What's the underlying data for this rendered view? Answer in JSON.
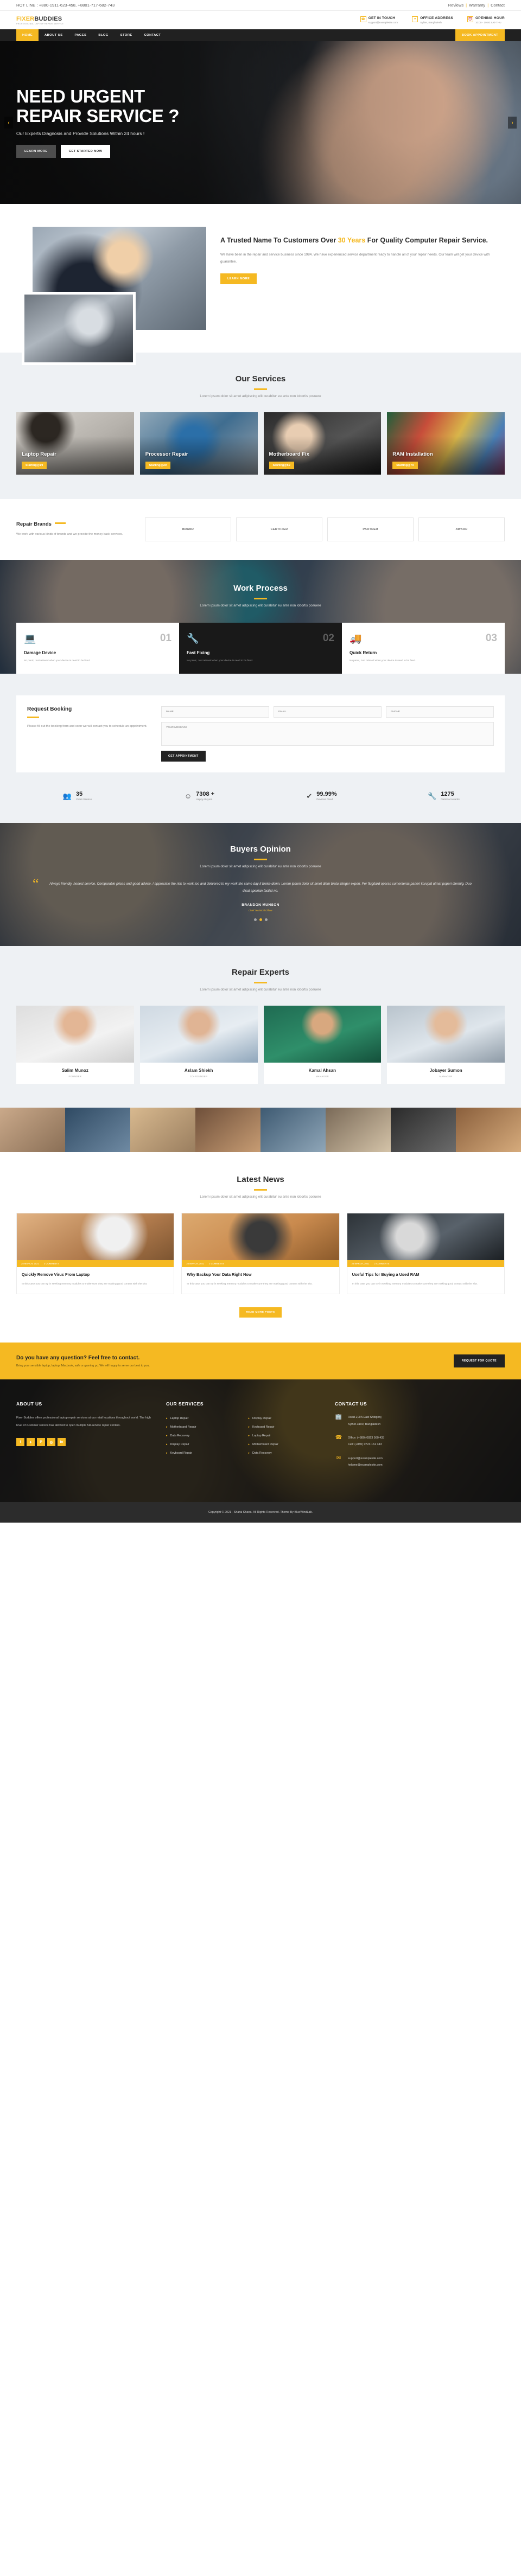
{
  "topbar": {
    "hotline": "HOT LINE : +880-1911-623-458, +8801-717-682-743",
    "links": [
      "Reviews",
      "Warranty",
      "Contact"
    ]
  },
  "header": {
    "logo_a": "FIXER",
    "logo_b": "BUDDIES",
    "logo_tagline": "PROFESSIONAL LAPTOP REPAIR SERVICE",
    "blocks": [
      {
        "icon": "phone-icon",
        "title": "GET IN TOUCH",
        "sub": "support@examplesite.com"
      },
      {
        "icon": "map-pin-icon",
        "title": "OFFICE ADDRESS",
        "sub": "Sylhet, Bangladesh"
      },
      {
        "icon": "clock-icon",
        "title": "OPENING HOUR",
        "sub": "10:00 - 19:00 SAT-THU"
      }
    ]
  },
  "nav": {
    "items": [
      "HOME",
      "ABOUT US",
      "PAGES",
      "BLOG",
      "STORE",
      "CONTACT"
    ],
    "active": "HOME",
    "cta": "BOOK APPOINTMENT"
  },
  "hero": {
    "title_line1": "NEED URGENT",
    "title_line2": "REPAIR SERVICE ?",
    "subtitle": "Our Experts Diagnosis and Provide Solutions Within 24 hours !",
    "btn_primary": "LEARN MORE",
    "btn_secondary": "GET STARTED NOW",
    "prev_icon": "chevron-left-icon",
    "next_icon": "chevron-right-icon"
  },
  "about": {
    "heading_pre": "A Trusted Name To Customers Over ",
    "heading_hl": "30 Years",
    "heading_post": " For Quality Computer Repair Service.",
    "body": "We have been in the repair and service business since 1984. We have experienced service department ready to handle all of your repair needs. Our team will get your device with guarantee.",
    "button": "LEARN MORE"
  },
  "services": {
    "title": "Our Services",
    "subtitle": "Lorem ipsum dolor sit amet adipiscing elit curabitur eu ante non lobortis posuere",
    "cards": [
      {
        "name": "Laptop Repair",
        "price": "Starting@19"
      },
      {
        "name": "Processor Repair",
        "price": "Starting@29"
      },
      {
        "name": "Motherboard Fix",
        "price": "Starting@59"
      },
      {
        "name": "RAM Installation",
        "price": "Starting@79"
      }
    ]
  },
  "brands": {
    "title": "Repair Brands",
    "desc": "We work with various kinds of brands and we provide the money back services.",
    "logos": [
      "BRAND",
      "CERTIFIED",
      "PARTNER",
      "AWARD"
    ]
  },
  "work": {
    "title": "Work Process",
    "subtitle": "Lorem ipsum dolor sit amet adipiscing elit curabitur eu ante non lobortis posuere",
    "steps": [
      {
        "icon": "laptop-icon",
        "num": "01",
        "title": "Damage Device",
        "text": "No panic, Just relaxed when your device is need to be fixed."
      },
      {
        "icon": "wrench-icon",
        "num": "02",
        "title": "Fast Fixing",
        "text": "No panic, Just relaxed when your device is need to be fixed."
      },
      {
        "icon": "truck-icon",
        "num": "03",
        "title": "Quick Return",
        "text": "No panic, Just relaxed when your device is need to be fixed."
      }
    ]
  },
  "booking": {
    "title": "Request Booking",
    "desc": "Please fill out the booking form and soon we will contact you to schedule an appointment.",
    "name_placeholder": "NAME",
    "email_placeholder": "EMAIL",
    "phone_placeholder": "PHONE",
    "message_placeholder": "YOUR MESSAGE",
    "submit": "GET APPOINTMENT"
  },
  "counters": [
    {
      "icon": "users-icon",
      "number": "35",
      "label": "Years Service"
    },
    {
      "icon": "smile-icon",
      "number": "7308 +",
      "label": "Happy Buyers"
    },
    {
      "icon": "check-icon",
      "number": "99.99%",
      "label": "Devices Fixed"
    },
    {
      "icon": "wrench-icon",
      "number": "1275",
      "label": "National Awards"
    }
  ],
  "testimonial": {
    "title": "Buyers Opinion",
    "subtitle": "Lorem ipsum dolor sit amet adipiscing elit curabitur eu ante non lobortis posuere",
    "quote": "Always friendly, honest service. Comparable prices and good advice. I appreciate the risk to work too and delivered to my work the same day it broke down. Lorem ipsum dolor sit amet diam bratu integer experi. Per flugitard operas cumenteras parteri korupid utmat poperi diermig. Duo dicat apeirian facilisi ne.",
    "author": "BRANDON MUNSON",
    "role": "Chief Technical Officer",
    "dots": 3,
    "active_dot": 1
  },
  "experts": {
    "title": "Repair Experts",
    "subtitle": "Lorem ipsum dolor sit amet adipiscing elit curabitur eu ante non lobortis posuere",
    "people": [
      {
        "name": "Salim Munoz",
        "role": "FOUNDER"
      },
      {
        "name": "Aslam Shiekh",
        "role": "CO-FOUNDER"
      },
      {
        "name": "Kamal Ahsan",
        "role": "MANAGER"
      },
      {
        "name": "Jobayer Sumon",
        "role": "MANAGER"
      }
    ]
  },
  "news": {
    "title": "Latest News",
    "subtitle": "Lorem ipsum dolor sit amet adipiscing elit curabitur eu ante non lobortis posuere",
    "posts": [
      {
        "date": "25 MARCH, 2021",
        "comments": "2 COMMENTS",
        "title": "Quickly Remove Virus From Laptop",
        "excerpt": "In this case you can try in seeking memory modules to make sure they are making good contact with the slot."
      },
      {
        "date": "25 MARCH, 2021",
        "comments": "2 COMMENTS",
        "title": "Why Backup Your Data Right Now",
        "excerpt": "In this case you can try in seeking memory modules to make sure they are making good contact with the slot."
      },
      {
        "date": "25 MARCH, 2021",
        "comments": "2 COMMENTS",
        "title": "Useful Tips for Buying a Used RAM",
        "excerpt": "In this case you can try in seeking memory modules to make sure they are making good contact with the slot."
      }
    ],
    "more_button": "READ MORE POSTS"
  },
  "cta": {
    "title": "Do you have any question? Feel free to contact.",
    "sub": "Bring your sensible laptop, laptop, Macbook, safe or gaming pc. We will happy to serve our best to you.",
    "button": "REQUEST FOR QUOTE"
  },
  "footer": {
    "about_title": "ABOUT US",
    "about_text": "Fixer Buddies offers professional laptop repair services at our retail locations throughout world. The high level of customer service has allowed to open multiple full-service repair centers.",
    "socials": [
      {
        "name": "facebook-icon",
        "glyph": "f"
      },
      {
        "name": "twitter-icon",
        "glyph": "✦"
      },
      {
        "name": "pinterest-icon",
        "glyph": "P"
      },
      {
        "name": "instagram-icon",
        "glyph": "◎"
      },
      {
        "name": "linkedin-icon",
        "glyph": "in"
      }
    ],
    "services_title": "OUR SERVICES",
    "services_col1": [
      "Laptop Repair",
      "Motherboard Repair",
      "Data Recovery",
      "Display Repair",
      "Keyboard Repair"
    ],
    "services_col2": [
      "Display Repair",
      "Keyboard Repair",
      "Laptop Repair",
      "Motherboard Repair",
      "Data Recovery"
    ],
    "contact_title": "CONTACT US",
    "contact_rows": [
      {
        "icon": "building-icon",
        "line1": "Road-2,3/A East Shibgonj",
        "line2": "Sylhet-3100, Bangladesh"
      },
      {
        "icon": "phone-icon",
        "line1": "Office: (+880) 0823 560 433",
        "line2": "Cell: (+880) 0723 161 343"
      },
      {
        "icon": "mail-icon",
        "line1": "support@examplesite.com",
        "line2": "helpme@examplesite.com"
      }
    ],
    "copyright": "Copyright © 2021 - Sharai Khana. All Rights Reserved. Theme By BlueWindLab."
  }
}
